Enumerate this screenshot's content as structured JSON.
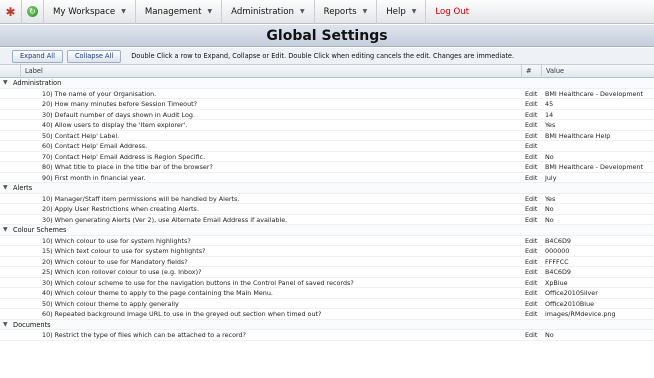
{
  "nav": {
    "settings_icon": "settings-icon",
    "refresh_icon": "refresh-icon",
    "items": [
      {
        "label": "My Workspace"
      },
      {
        "label": "Management"
      },
      {
        "label": "Administration"
      },
      {
        "label": "Reports"
      },
      {
        "label": "Help"
      }
    ],
    "logout": "Log Out",
    "caret": "▼"
  },
  "page": {
    "title": "Global Settings"
  },
  "toolbar": {
    "expand_all": "Expand All",
    "collapse_all": "Collapse All",
    "info": "Double Click a row to Expand, Collapse or Edit. Double Click when editing cancels the edit. Changes are immediate."
  },
  "grid": {
    "columns": {
      "label": "Label",
      "hash": "#",
      "value": "Value"
    },
    "groups": [
      {
        "name": "Administration",
        "rows": [
          {
            "label": "10) The name of your Organisation.",
            "edit": "Edit",
            "value": "BMI Healthcare - Development"
          },
          {
            "label": "20) How many minutes before Session Timeout?",
            "edit": "Edit",
            "value": "45"
          },
          {
            "label": "30) Default number of days shown in Audit Log.",
            "edit": "Edit",
            "value": "14"
          },
          {
            "label": "40) Allow users to display the 'Item explorer'.",
            "edit": "Edit",
            "value": "Yes"
          },
          {
            "label": "50) Contact Help' Label.",
            "edit": "Edit",
            "value": "BMI Healthcare Help"
          },
          {
            "label": "60) Contact Help' Email Address.",
            "edit": "Edit",
            "value": ""
          },
          {
            "label": "70) Contact Help' Email Address is Region Specific.",
            "edit": "Edit",
            "value": "No"
          },
          {
            "label": "80) What title to place in the title bar of the browser?",
            "edit": "Edit",
            "value": "BMI Healthcare - Development"
          },
          {
            "label": "90) First month in financial year.",
            "edit": "Edit",
            "value": "July"
          }
        ]
      },
      {
        "name": "Alerts",
        "rows": [
          {
            "label": "10) Manager/Staff item permissions will be handled by Alerts.",
            "edit": "Edit",
            "value": "Yes"
          },
          {
            "label": "20) Apply User Restrictions when creating Alerts.",
            "edit": "Edit",
            "value": "No"
          },
          {
            "label": "30) When generating Alerts (Ver 2), use Alternate Email Address if available.",
            "edit": "Edit",
            "value": "No"
          }
        ]
      },
      {
        "name": "Colour Schemes",
        "rows": [
          {
            "label": "10) Which colour to use for system highlights?",
            "edit": "Edit",
            "value": "B4C6D9"
          },
          {
            "label": "15) Which text colour to use for system highlights?",
            "edit": "Edit",
            "value": "000000"
          },
          {
            "label": "20) Which colour to use for Mandatory fields?",
            "edit": "Edit",
            "value": "FFFFCC"
          },
          {
            "label": "25) Which icon rollover colour to use (e.g. Inbox)?",
            "edit": "Edit",
            "value": "B4C6D9"
          },
          {
            "label": "30) Which colour scheme to use for the navigation buttons in the Control Panel of saved records?",
            "edit": "Edit",
            "value": "XpBlue"
          },
          {
            "label": "40) Which colour theme to apply to the page containing the Main Menu.",
            "edit": "Edit",
            "value": "Office2010Silver"
          },
          {
            "label": "50) Which colour theme to apply generally",
            "edit": "Edit",
            "value": "Office2010Blue"
          },
          {
            "label": "60) Repeated background Image URL to use in the greyed out section when timed out?",
            "edit": "Edit",
            "value": "images/RMdevice.png"
          }
        ]
      },
      {
        "name": "Documents",
        "rows": [
          {
            "label": "10) Restrict the type of files which can be attached to a record?",
            "edit": "Edit",
            "value": "No"
          }
        ]
      }
    ]
  }
}
